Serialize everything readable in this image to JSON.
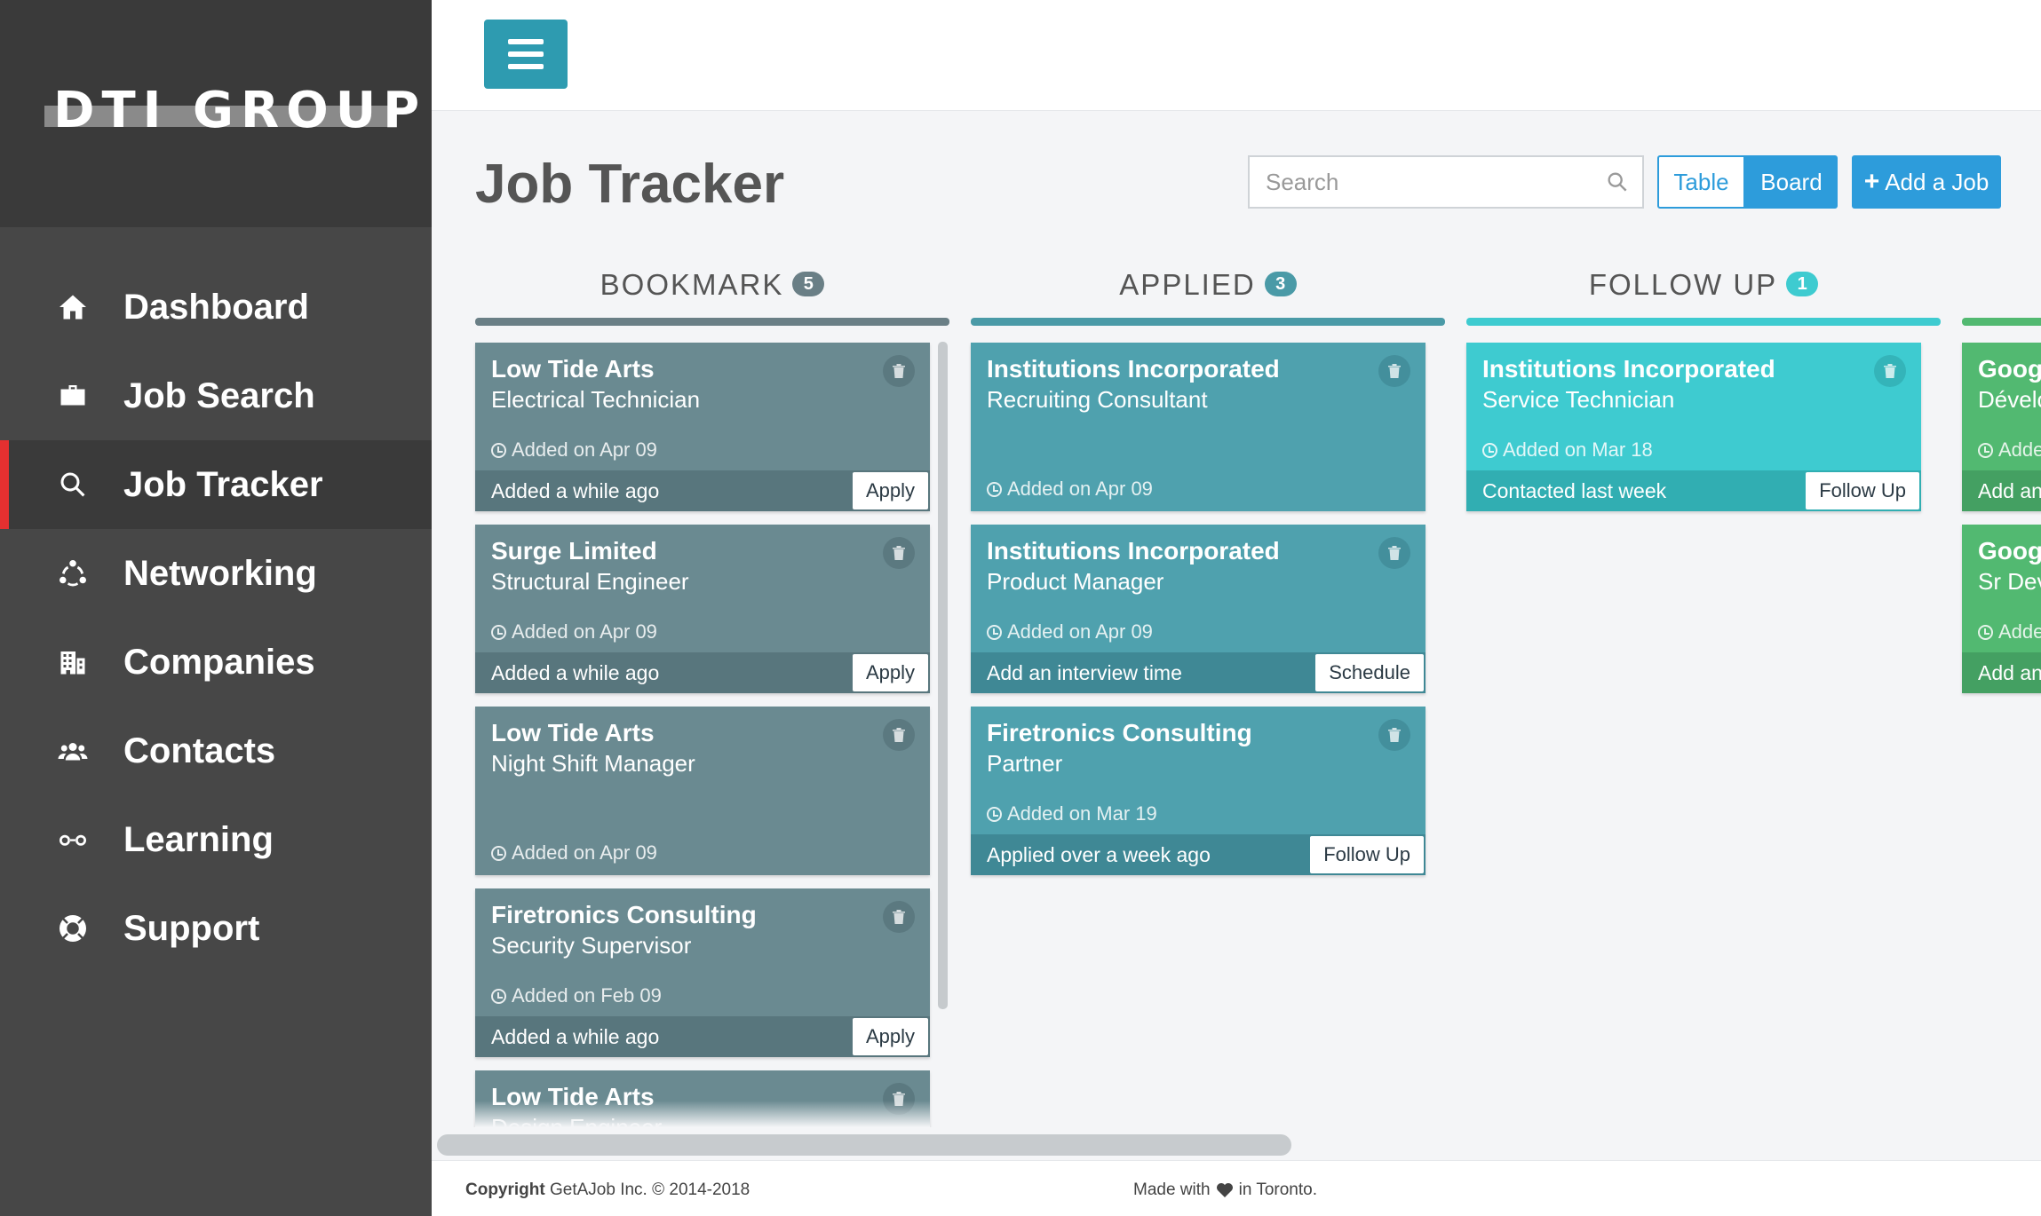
{
  "brand": {
    "logo_text": "DTI GROUP"
  },
  "nav": [
    {
      "label": "Dashboard",
      "icon": "home-icon"
    },
    {
      "label": "Job Search",
      "icon": "briefcase-icon"
    },
    {
      "label": "Job Tracker",
      "icon": "search-icon",
      "active": true
    },
    {
      "label": "Networking",
      "icon": "network-icon"
    },
    {
      "label": "Companies",
      "icon": "building-icon"
    },
    {
      "label": "Contacts",
      "icon": "users-icon"
    },
    {
      "label": "Learning",
      "icon": "glasses-icon"
    },
    {
      "label": "Support",
      "icon": "lifebuoy-icon"
    }
  ],
  "page": {
    "title": "Job Tracker"
  },
  "search": {
    "placeholder": "Search"
  },
  "view_toggle": {
    "table": "Table",
    "board": "Board",
    "selected": "Board"
  },
  "add_job": {
    "plus": "+",
    "label": "Add a Job"
  },
  "colors": {
    "accent": "#2d9cdb",
    "menu_button": "#2e9bb0",
    "active_nav_marker": "#e53030",
    "bookmark": "#6a8a91",
    "applied": "#4fa1ae",
    "follow_up": "#3ecbd0",
    "interview": "#52b971"
  },
  "columns": [
    {
      "title": "BOOKMARK",
      "count": "5",
      "line_color": "#6a7f86",
      "badge_color": "#6a7f86",
      "cards": [
        {
          "company": "Low Tide Arts",
          "role": "Electrical Technician",
          "added": "Added on Apr 09",
          "footer": "Added a while ago",
          "action": "Apply"
        },
        {
          "company": "Surge Limited",
          "role": "Structural Engineer",
          "added": "Added on Apr 09",
          "footer": "Added a while ago",
          "action": "Apply"
        },
        {
          "company": "Low Tide Arts",
          "role": "Night Shift Manager",
          "added": "Added on Apr 09"
        },
        {
          "company": "Firetronics Consulting",
          "role": "Security Supervisor",
          "added": "Added on Feb 09",
          "footer": "Added a while ago",
          "action": "Apply"
        },
        {
          "company": "Low Tide Arts",
          "role": "Design Engineer"
        }
      ]
    },
    {
      "title": "APPLIED",
      "count": "3",
      "line_color": "#4a9aa7",
      "badge_color": "#4a9aa7",
      "cards": [
        {
          "company": "Institutions Incorporated",
          "role": "Recruiting Consultant",
          "added": "Added on Apr 09"
        },
        {
          "company": "Institutions Incorporated",
          "role": "Product Manager",
          "added": "Added on Apr 09",
          "footer": "Add an interview time",
          "action": "Schedule"
        },
        {
          "company": "Firetronics Consulting",
          "role": "Partner",
          "added": "Added on Mar 19",
          "footer": "Applied over a week ago",
          "action": "Follow Up"
        }
      ]
    },
    {
      "title": "FOLLOW UP",
      "count": "1",
      "line_color": "#3ecbd0",
      "badge_color": "#3ecbd0",
      "cards": [
        {
          "company": "Institutions Incorporated",
          "role": "Service Technician",
          "added": "Added on Mar 18",
          "footer": "Contacted last week",
          "action": "Follow Up"
        }
      ]
    },
    {
      "title": "",
      "count": "",
      "line_color": "#52b971",
      "badge_color": "#52b971",
      "cards": [
        {
          "company": "Googl",
          "role": "Dévelo",
          "added": "Adde",
          "footer": "Add an"
        },
        {
          "company": "Googl",
          "role": "Sr Dev",
          "added": "Adde",
          "footer": "Add an"
        }
      ]
    }
  ],
  "footer": {
    "copyright_bold": "Copyright",
    "copyright_rest": "GetAJob Inc. © 2014-2018",
    "made_with": "Made with",
    "in_city": "in Toronto."
  }
}
